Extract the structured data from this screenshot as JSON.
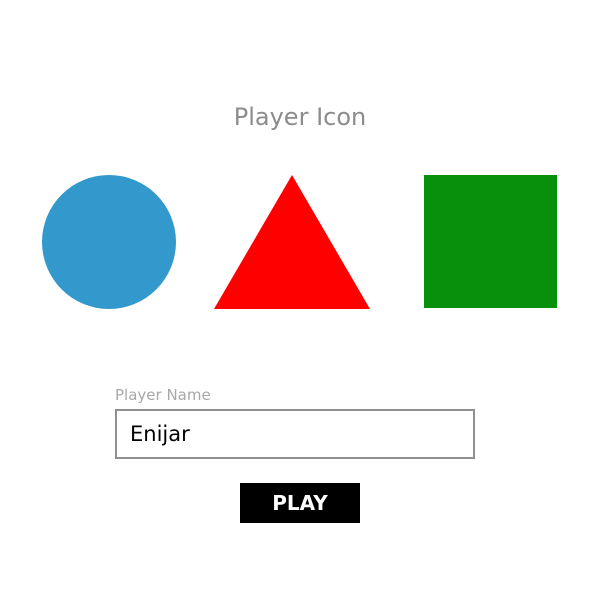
{
  "icon_picker": {
    "title": "Player Icon",
    "options": [
      {
        "shape": "circle-icon",
        "color": "#3399cc"
      },
      {
        "shape": "triangle-icon",
        "color": "#ff0000"
      },
      {
        "shape": "square-icon",
        "color": "#08900c"
      }
    ]
  },
  "name_field": {
    "label": "Player Name",
    "value": "Enijar",
    "placeholder": ""
  },
  "play_button": {
    "label": "PLAY"
  }
}
